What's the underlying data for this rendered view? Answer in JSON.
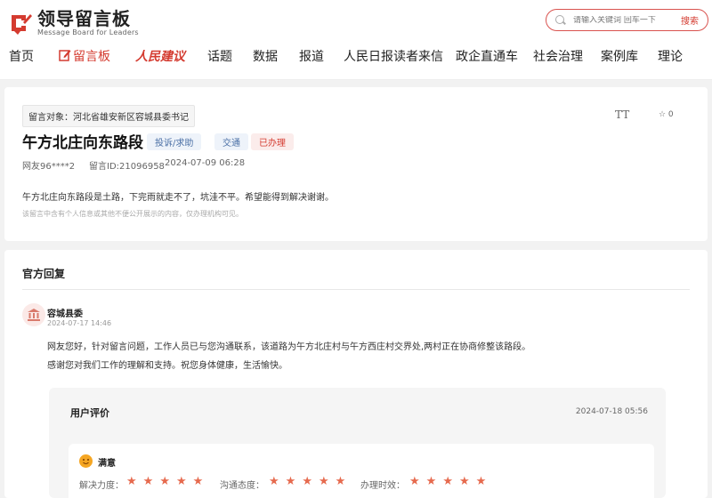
{
  "header": {
    "logo_title": "领导留言板",
    "logo_sub": "Message Board for Leaders",
    "search": {
      "placeholder": "请输入关键词 回车一下",
      "button": "搜索"
    }
  },
  "nav": [
    {
      "label": "首页"
    },
    {
      "label": "留言板",
      "active": true
    },
    {
      "label": "人民建议"
    },
    {
      "label": "话题"
    },
    {
      "label": "数据"
    },
    {
      "label": "报道"
    },
    {
      "label": "人民日报读者来信"
    },
    {
      "label": "政企直通车"
    },
    {
      "label": "社会治理"
    },
    {
      "label": "案例库"
    },
    {
      "label": "理论"
    }
  ],
  "message": {
    "target": "留言对象：河北省雄安新区容城县委书记",
    "title": "午方北庄向东路段",
    "badges": {
      "type": "投诉/求助",
      "category": "交通",
      "status": "已办理"
    },
    "author": "网友96****2",
    "id": "留言ID:21096958",
    "date": "2024-07-09 06:28",
    "body": "午方北庄向东路段是土路，下完雨就走不了，坑洼不平。希望能得到解决谢谢。",
    "note": "该留言中含有个人信息或其他不便公开展示的内容，仅办理机构可见。",
    "font_button": "TT",
    "fav_count": "☆ 0"
  },
  "reply": {
    "section_title": "官方回复",
    "org": "容城县委",
    "date": "2024-07-17 14:46",
    "lines": [
      "网友您好，针对留言问题，工作人员已与您沟通联系，该道路为午方北庄村与午方西庄村交界处,两村正在协商修整该路段。",
      "感谢您对我们工作的理解和支持。祝您身体健康，生活愉快。"
    ]
  },
  "evaluation": {
    "title": "用户评价",
    "date": "2024-07-18 05:56",
    "satisfaction": "满意",
    "ratings": [
      {
        "label": "解决力度：",
        "stars": 5
      },
      {
        "label": "沟通态度：",
        "stars": 5
      },
      {
        "label": "办理时效：",
        "stars": 5
      }
    ]
  },
  "colors": {
    "brand": "#d43b30",
    "tag_blue": "#4a6fa5",
    "star": "#e66a4e"
  }
}
